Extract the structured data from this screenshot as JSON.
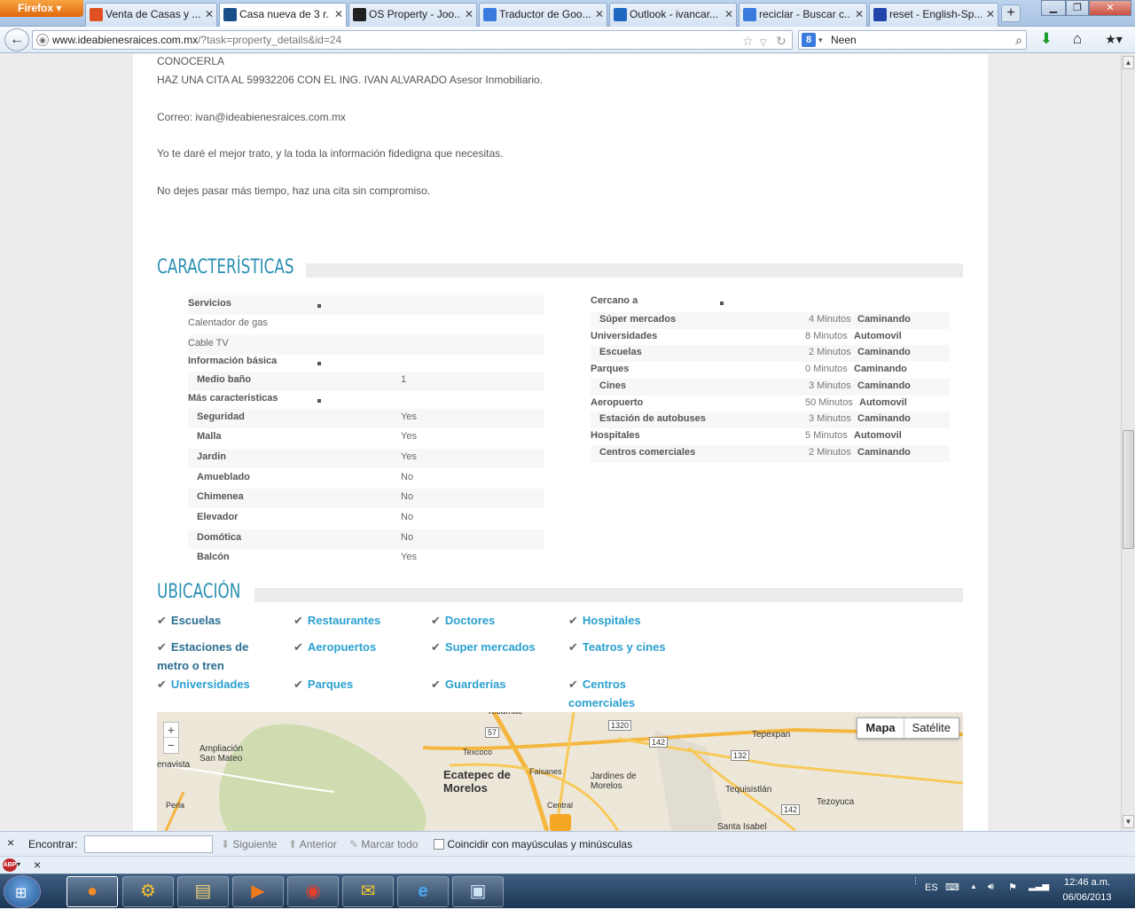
{
  "browser": {
    "menu_label": "Firefox",
    "tabs": [
      {
        "label": "Venta de Casas y ...",
        "icon": "check-favicon",
        "color": "#e05020",
        "active": false
      },
      {
        "label": "Casa nueva de 3 r...",
        "icon": "person-favicon",
        "color": "#1a4f8a",
        "active": true
      },
      {
        "label": "OS Property - Joo...",
        "icon": "joomla-favicon",
        "color": "#222222",
        "active": false
      },
      {
        "label": "Traductor de Goo...",
        "icon": "translate-favicon",
        "color": "#3a7be0",
        "active": false
      },
      {
        "label": "Outlook - ivancar...",
        "icon": "outlook-favicon",
        "color": "#1e68c2",
        "active": false
      },
      {
        "label": "reciclar - Buscar c...",
        "icon": "google-favicon",
        "color": "#3a7be0",
        "active": false
      },
      {
        "label": "reset - English-Sp...",
        "icon": "wordreference-favicon",
        "color": "#2244aa",
        "active": false
      }
    ],
    "new_tab": "+",
    "url_domain": "www.ideabienesraices.com.mx",
    "url_rest": "/?task=property_details&id=24",
    "search_value": "Neen",
    "search_engine_letter": "8"
  },
  "page": {
    "intro_lines": [
      "CONOCERLA",
      "HAZ UNA CITA AL 59932206 CON EL ING. IVAN ALVARADO Asesor Inmobiliario.",
      "Correo: ivan@ideabienesraices.com.mx",
      "Yo te daré el mejor trato, y la toda la información fidedigna que necesitas.",
      "No dejes pasar más tiempo, haz una cita sin compromiso."
    ],
    "features_title": "CARACTERÍSTICAS",
    "features_left": [
      {
        "label": "Servicios",
        "value": "",
        "bold": true,
        "bullet": true
      },
      {
        "label": "Calentador de gas",
        "value": "",
        "bold": false,
        "bullet": false
      },
      {
        "label": "Cable TV",
        "value": "",
        "bold": false,
        "bullet": false
      },
      {
        "label": "Información básica",
        "value": "",
        "bold": true,
        "bullet": true
      },
      {
        "label": "Medio baño",
        "value": "1",
        "bold": true,
        "bullet": false
      },
      {
        "label": "Más caracteristicas",
        "value": "",
        "bold": true,
        "bullet": true
      },
      {
        "label": "Seguridad",
        "value": "Yes",
        "bold": true,
        "bullet": false
      },
      {
        "label": "Malla",
        "value": "Yes",
        "bold": true,
        "bullet": false
      },
      {
        "label": "Jardin",
        "value": "Yes",
        "bold": true,
        "bullet": false
      },
      {
        "label": "Amueblado",
        "value": "No",
        "bold": true,
        "bullet": false
      },
      {
        "label": "Chimenea",
        "value": "No",
        "bold": true,
        "bullet": false
      },
      {
        "label": "Elevador",
        "value": "No",
        "bold": true,
        "bullet": false
      },
      {
        "label": "Domótica",
        "value": "No",
        "bold": true,
        "bullet": false
      },
      {
        "label": "Balcón",
        "value": "Yes",
        "bold": true,
        "bullet": false
      }
    ],
    "nearby_title": "Cercano a",
    "nearby": [
      {
        "label": "Súper mercados",
        "minutes": "4 Minutos",
        "mode": "Caminando"
      },
      {
        "label": "Universidades",
        "minutes": "8 Minutos",
        "mode": "Automovil"
      },
      {
        "label": "Escuelas",
        "minutes": "2 Minutos",
        "mode": "Caminando"
      },
      {
        "label": "Parques",
        "minutes": "0 Minutos",
        "mode": "Caminando"
      },
      {
        "label": "Cines",
        "minutes": "3 Minutos",
        "mode": "Caminando"
      },
      {
        "label": "Aeropuerto",
        "minutes": "50 Minutos",
        "mode": "Automovil"
      },
      {
        "label": "Estación de autobuses",
        "minutes": "3 Minutos",
        "mode": "Caminando"
      },
      {
        "label": "Hospitales",
        "minutes": "5 Minutos",
        "mode": "Automovil"
      },
      {
        "label": "Centros comerciales",
        "minutes": "2 Minutos",
        "mode": "Caminando"
      }
    ],
    "location_title": "UBICACIÓN",
    "location_links": [
      "Escuelas",
      "Restaurantes",
      "Doctores",
      "Hospitales",
      "Estaciones de metro o tren",
      "Aeropuertos",
      "Super mercados",
      "Teatros y cines",
      "Universidades",
      "Parques",
      "Guarderias",
      "Centros comerciales"
    ],
    "map": {
      "type_map": "Mapa",
      "type_sat": "Satélite",
      "zoom_in": "+",
      "zoom_out": "−",
      "labels": [
        "Tecámac",
        "Ampliación San Mateo",
        "enavista",
        "Ecatepec de Morelos",
        "Jardines de Morelos",
        "Tepexpan",
        "Tequisistlán",
        "Tezoyuca",
        "Santa Isabel",
        "Texcoco",
        "Faisanes",
        "Central",
        "Perla",
        "57",
        "1320",
        "142",
        "132",
        "142"
      ]
    }
  },
  "findbar": {
    "close": "×",
    "label": "Encontrar:",
    "next": "Siguiente",
    "prev": "Anterior",
    "highlight": "Marcar todo",
    "match_case": "Coincidir con mayúsculas y minúsculas"
  },
  "addonbar": {
    "abp": "ABP",
    "close": "×"
  },
  "taskbar": {
    "apps": [
      "firefox-icon",
      "tools-icon",
      "explorer-icon",
      "media-player-icon",
      "chrome-icon",
      "outlook-icon",
      "ie-icon",
      "remote-desktop-icon"
    ],
    "lang": "ES",
    "time": "12:46 a.m.",
    "date": "06/06/2013"
  }
}
